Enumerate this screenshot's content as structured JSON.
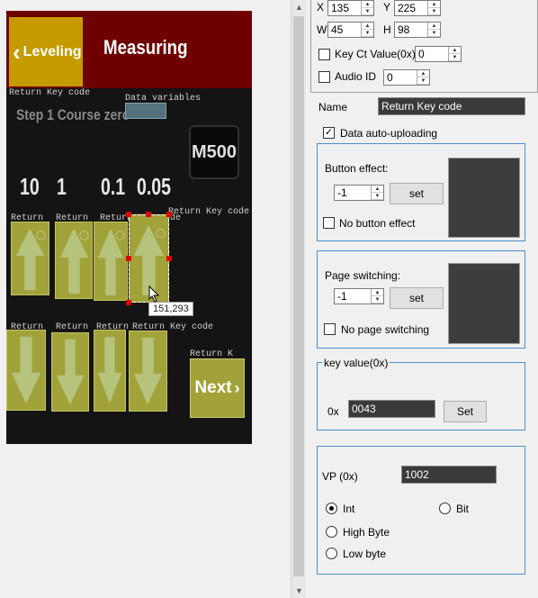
{
  "canvas": {
    "level_label": "Leveling",
    "title": "Measuring",
    "step_label": "Step 1 Course zero",
    "badge": "M500",
    "steps": [
      "10",
      "1",
      "0.1",
      "0.05"
    ],
    "next_label": "Next",
    "overlay_return_keycode": "Return Key code",
    "overlay_data_variables": "Data variables",
    "overlay_return_short": "Return",
    "overlay_return_key": "Return Key code",
    "overlay_return_e": "Return K",
    "tooltip": "151,293",
    "colors": {
      "header": "#6e0000",
      "accent": "#c59b00",
      "button": "#a2a23a"
    }
  },
  "props": {
    "x_label": "X",
    "x_value": "135",
    "y_label": "Y",
    "y_value": "225",
    "w_label": "W",
    "w_value": "45",
    "h_label": "H",
    "h_value": "98",
    "keyct_label": "Key Ct Value(0x)",
    "keyct_value": "0",
    "audio_label": "Audio ID",
    "audio_value": "0",
    "name_label": "Name",
    "name_value": "Return Key code",
    "auto_upload_label": "Data auto-uploading",
    "button_effect_label": "Button effect:",
    "button_effect_value": "-1",
    "set_label": "set",
    "no_button_effect_label": "No button effect",
    "page_switching_label": "Page switching:",
    "page_switching_value": "-1",
    "no_page_switching_label": "No page switching",
    "key_value_label": "key value(0x)",
    "hex_prefix": "0x",
    "key_value": "0043",
    "set_cap_label": "Set",
    "vp_label": "VP (0x)",
    "vp_value": "1002",
    "int_label": "Int",
    "bit_label": "Bit",
    "high_byte_label": "High Byte",
    "low_byte_label": "Low byte"
  }
}
